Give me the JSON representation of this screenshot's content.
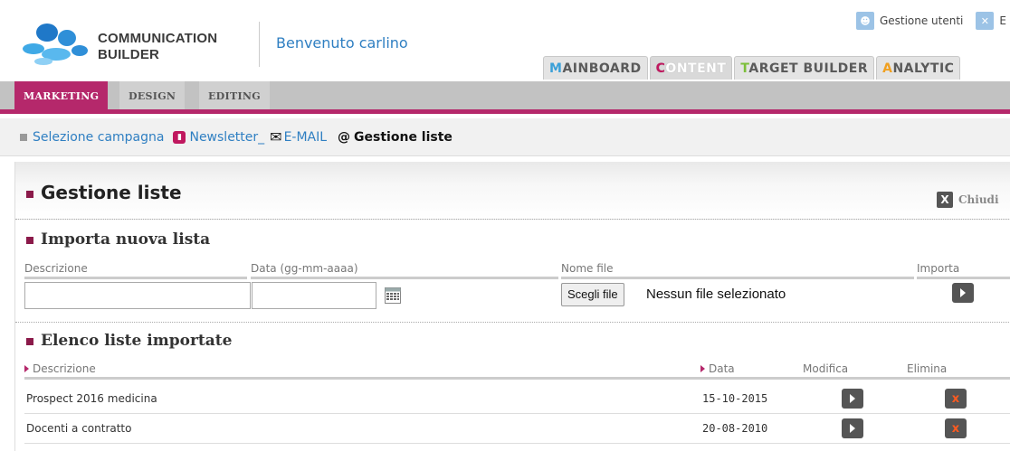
{
  "app": {
    "brand_line1": "COMMUNICATION",
    "brand_line2": "BUILDER",
    "welcome": "Benvenuto carlino"
  },
  "top_links": {
    "users_label": "Gestione utenti",
    "exit_label": "E"
  },
  "main_tabs": [
    {
      "first": "M",
      "rest": "AINBOARD",
      "first_color": "#3aa0d8",
      "active": false
    },
    {
      "first": "C",
      "rest": "ONTENT",
      "first_color": "#c0185f",
      "active": true
    },
    {
      "first": "T",
      "rest": "ARGET BUILDER",
      "first_color": "#7cbf3a",
      "active": false
    },
    {
      "first": "A",
      "rest": "NALYTIC",
      "first_color": "#f0a020",
      "active": false
    }
  ],
  "sub_tabs": [
    "MARKETING",
    "DESIGN",
    "EDITING"
  ],
  "breadcrumb": {
    "item1": "Selezione campagna",
    "item2": "Newsletter_",
    "item3": "E-MAIL",
    "current": "Gestione liste"
  },
  "panel": {
    "title": "Gestione liste",
    "close_label": "Chiudi"
  },
  "import_section": {
    "title": "Importa nuova lista",
    "col_desc": "Descrizione",
    "col_date": "Data (gg-mm-aaaa)",
    "col_file": "Nome file",
    "col_import": "Importa",
    "file_button": "Scegli file",
    "file_status": "Nessun file selezionato"
  },
  "list_section": {
    "title": "Elenco liste importate",
    "col_desc": "Descrizione",
    "col_date": "Data",
    "col_edit": "Modifica",
    "col_delete": "Elimina",
    "rows": [
      {
        "desc": "Prospect 2016 medicina",
        "date": "15-10-2015"
      },
      {
        "desc": "Docenti a contratto",
        "date": "20-08-2010"
      }
    ]
  },
  "colors": {
    "accent": "#b5286b",
    "link": "#2f7fc2"
  }
}
